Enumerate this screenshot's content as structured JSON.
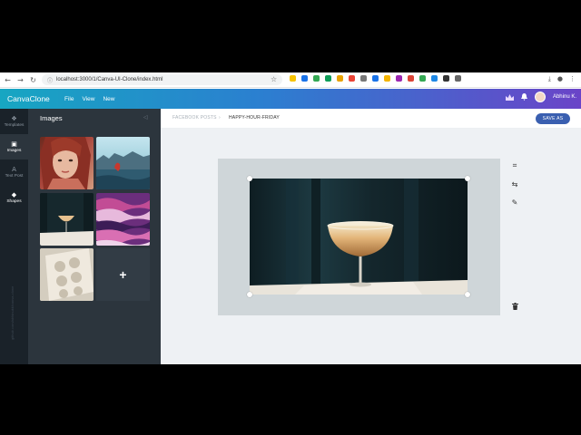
{
  "browser": {
    "url": "localhost:3000/1/Canva-UI-Clone/index.html",
    "nav": {
      "back": "←",
      "forward": "→",
      "reload": "↻"
    },
    "extension_colors": [
      "#f7c300",
      "#1a73e8",
      "#34a853",
      "#0f9d58",
      "#e8a200",
      "#ea4335",
      "#777777",
      "#1a73e8",
      "#f4b400",
      "#9c27b0",
      "#db4437",
      "#34a853",
      "#1e88e5",
      "#333333",
      "#666666"
    ]
  },
  "app": {
    "brand": "CanvaClone",
    "menu": [
      "File",
      "View",
      "New"
    ],
    "user_name": "Abhinu K."
  },
  "rail": {
    "items": [
      {
        "label": "Templates",
        "icon": "layers-icon",
        "glyph": "❖"
      },
      {
        "label": "Images",
        "icon": "image-icon",
        "glyph": "▣"
      },
      {
        "label": "Text Post",
        "icon": "text-icon",
        "glyph": "A"
      },
      {
        "label": "Shapes",
        "icon": "shapes-icon",
        "glyph": "◆"
      }
    ],
    "footer_text": "github.com/abhinukk/canva-clone"
  },
  "panel": {
    "title": "Images",
    "collapse": "◁",
    "add_label": "+"
  },
  "editor": {
    "breadcrumb_root": "FACEBOOK POSTS",
    "breadcrumb_sep": "›",
    "breadcrumb_current": "HAPPY-HOUR-FRIDAY",
    "save_label": "SAVE AS"
  },
  "tools": {
    "crop": "⌗",
    "flip": "⇆",
    "edit": "✎",
    "delete": "🗑"
  },
  "colors": {
    "rail": "#1a2229",
    "panel": "#2c353d",
    "save_button": "#3a5fb0",
    "canvas_bg": "#eef1f4"
  }
}
